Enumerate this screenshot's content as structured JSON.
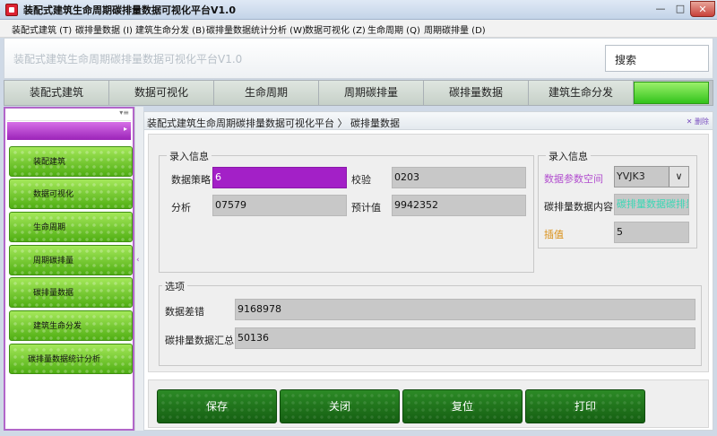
{
  "window": {
    "title": "装配式建筑生命周期碳排量数据可视化平台V1.0",
    "min_icon": "minimize-icon",
    "max_icon": "maximize-icon",
    "close_icon": "close-icon",
    "min_glyph": "—",
    "max_glyph": "□",
    "close_glyph": "✕"
  },
  "menu": [
    "装配式建筑 (T)",
    "碳排量数据 (I)",
    "建筑生命分发 (B)",
    "碳排量数据统计分析 (W)",
    "数据可视化 (Z)",
    "生命周期 (Q)",
    "周期碳排量 (D)"
  ],
  "header": {
    "title": "装配式建筑生命周期碳排量数据可视化平台V1.0",
    "search_label": "搜索"
  },
  "tabs": [
    "装配式建筑",
    "数据可视化",
    "生命周期",
    "周期碳排量",
    "碳排量数据",
    "建筑生命分发"
  ],
  "sidebar": {
    "collapse_glyph": "▾≡",
    "header_glyph": "▸",
    "handle_glyph": "‹",
    "items": [
      "装配建筑",
      "数据可视化",
      "生命周期",
      "周期碳排量",
      "碳排量数据",
      "建筑生命分发",
      "碳排量数据统计分析"
    ]
  },
  "breadcrumb": {
    "text": "装配式建筑生命周期碳排量数据可视化平台 〉 碳排量数据",
    "close_label": "✕ 删除"
  },
  "form": {
    "group1_title": "录入信息",
    "strategy_label": "数据策略",
    "strategy_value": "6",
    "check_label": "校验",
    "check_value": "0203",
    "analysis_label": "分析",
    "analysis_value": "07579",
    "estimate_label": "预计值",
    "estimate_value": "9942352",
    "group2_title": "录入信息",
    "param_label": "数据参数空间",
    "param_value": "YVJK3",
    "param_dropdown_glyph": "∨",
    "content_label": "碳排量数据内容",
    "content_value": "碳排量数据碳排量",
    "interp_label": "插值",
    "interp_value": "5",
    "options_title": "选项",
    "error_label": "数据差错",
    "error_value": "9168978",
    "summary_label": "碳排量数据汇总",
    "summary_value": "50136"
  },
  "buttons": {
    "save": "保存",
    "close": "关闭",
    "reset": "复位",
    "print": "打印"
  },
  "colors": {
    "accent_purple": "#a320c7",
    "accent_green": "#4fae12",
    "button_green": "#1f7a1a"
  }
}
